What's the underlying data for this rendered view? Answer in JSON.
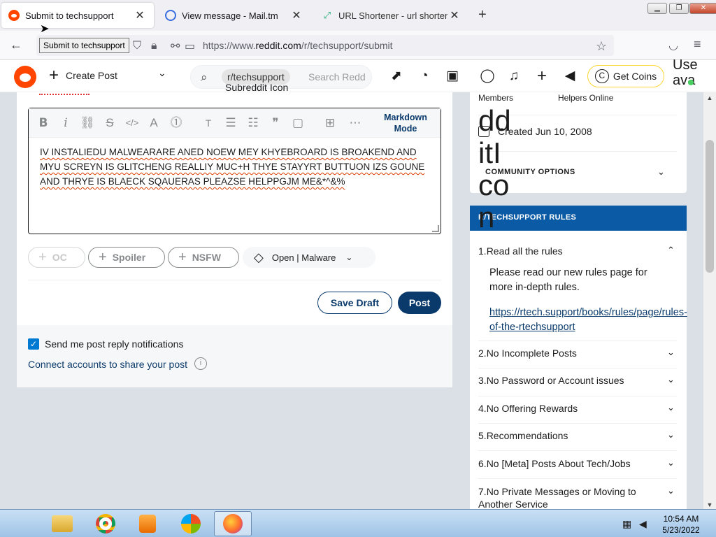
{
  "browser": {
    "tabs": [
      {
        "title": "Submit to techsupport",
        "favicon": "reddit-icon",
        "active": true
      },
      {
        "title": "View message - Mail.tm",
        "favicon": "mail-icon",
        "active": false
      },
      {
        "title": "URL Shortener - url shortening a",
        "favicon": "link-icon",
        "active": false
      }
    ],
    "new_tab": "+",
    "tooltip": "Submit to techsupport",
    "url_prefix": "https://www.",
    "url_domain": "reddit.com",
    "url_path": "/r/techsupport/submit"
  },
  "reddit_header": {
    "create_post": "Create Post",
    "search_chip": "r/techsupport",
    "search_placeholder": "Search Redd",
    "broken_icon_text": "Subreddit Icon",
    "get_coins": "Get Coins",
    "user_text": "Use ava"
  },
  "editor": {
    "markdown_mode": "Markdown Mode",
    "body_text": "IV INSTALIEDU MALWEARARE ANED NOEW MEY KHYEBROARD IS BROAKEND AND MYU SCREYN IS GLITCHENG REALLIY MUC+H THYE STAYYRT BUTTUON IZS GOUNE AND THRYE IS BLAECK SQAUERAS PLEAZSE HELPPGJM ME&*^&%"
  },
  "tags": {
    "oc": "OC",
    "spoiler": "Spoiler",
    "nsfw": "NSFW",
    "flair": "Open | Malware"
  },
  "actions": {
    "save_draft": "Save Draft",
    "post": "Post",
    "notify_label": "Send me post reply notifications",
    "notify_checked": true,
    "connect_accounts": "Connect accounts to share your post"
  },
  "sidebar": {
    "members_label": "Members",
    "helpers_label": "Helpers Online",
    "created": "Created Jun 10, 2008",
    "community_options": "COMMUNITY OPTIONS",
    "broken_icon_text": "dditIcon",
    "rules_header": "R/TECHSUPPORT RULES",
    "rules": [
      {
        "num": "1.",
        "title": "Read all the rules",
        "expanded": true
      },
      {
        "num": "2.",
        "title": "No Incomplete Posts"
      },
      {
        "num": "3.",
        "title": "No Password or Account issues"
      },
      {
        "num": "4.",
        "title": "No Offering Rewards"
      },
      {
        "num": "5.",
        "title": "Recommendations"
      },
      {
        "num": "6.",
        "title": "No [Meta] Posts About Tech/Jobs"
      },
      {
        "num": "7.",
        "title": "No Private Messages or Moving to Another Service"
      }
    ],
    "rule1_desc": "Please read our new rules page for more in-depth rules.",
    "rule1_link": "https://rtech.support/books/rules/page/rules-of-the-rtechsupport"
  },
  "taskbar": {
    "time": "10:54 AM",
    "date": "5/23/2022",
    "apps": [
      "file-explorer-icon",
      "chrome-icon",
      "media-player-icon",
      "windows-logo-icon",
      "firefox-icon"
    ]
  },
  "colors": {
    "reddit_orange": "#ff4500",
    "reddit_blue": "#0a3a6b",
    "rules_header_bg": "#0b5aa5",
    "coin_border": "#ffd635"
  }
}
